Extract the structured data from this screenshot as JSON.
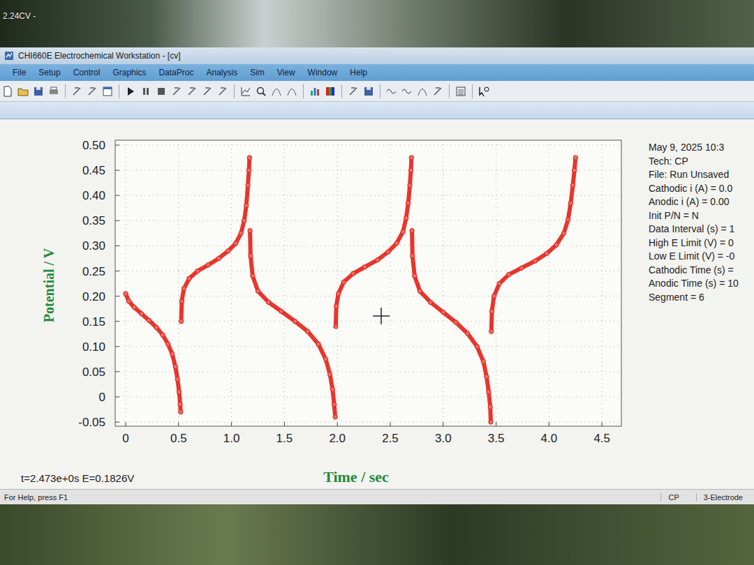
{
  "desktop": {
    "label": "2.24CV -"
  },
  "window": {
    "title": "CHI660E Electrochemical Workstation - [cv]"
  },
  "menu": [
    {
      "label": "File"
    },
    {
      "label": "Setup"
    },
    {
      "label": "Control"
    },
    {
      "label": "Graphics"
    },
    {
      "label": "DataProc"
    },
    {
      "label": "Analysis"
    },
    {
      "label": "Sim"
    },
    {
      "label": "View"
    },
    {
      "label": "Window"
    },
    {
      "label": "Help"
    }
  ],
  "chart": {
    "y_axis": {
      "title": "Potential / V",
      "ticks": [
        "0.50",
        "0.45",
        "0.40",
        "0.35",
        "0.30",
        "0.25",
        "0.20",
        "0.15",
        "0.10",
        "0.05",
        "0",
        "-0.05"
      ]
    },
    "x_axis": {
      "title": "Time / sec",
      "ticks": [
        "0",
        "0.5",
        "1.0",
        "1.5",
        "2.0",
        "2.5",
        "3.0",
        "3.5",
        "4.0",
        "4.5"
      ]
    },
    "segments": [
      {
        "time": [
          0,
          0.03,
          0.08,
          0.15,
          0.22,
          0.29,
          0.35,
          0.4,
          0.44,
          0.47,
          0.49,
          0.505,
          0.515,
          0.52
        ],
        "potential": [
          0.205,
          0.19,
          0.178,
          0.165,
          0.152,
          0.138,
          0.123,
          0.105,
          0.085,
          0.06,
          0.035,
          0.01,
          -0.015,
          -0.03
        ]
      },
      {
        "time": [
          0.525,
          0.53,
          0.55,
          0.6,
          0.68,
          0.78,
          0.88,
          0.97,
          1.04,
          1.09,
          1.12,
          1.14,
          1.155,
          1.165,
          1.17
        ],
        "potential": [
          0.15,
          0.19,
          0.215,
          0.235,
          0.25,
          0.262,
          0.275,
          0.29,
          0.305,
          0.325,
          0.35,
          0.38,
          0.42,
          0.45,
          0.475
        ]
      },
      {
        "time": [
          1.175,
          1.18,
          1.2,
          1.25,
          1.35,
          1.47,
          1.6,
          1.72,
          1.82,
          1.89,
          1.93,
          1.955,
          1.97,
          1.98
        ],
        "potential": [
          0.33,
          0.28,
          0.24,
          0.21,
          0.188,
          0.17,
          0.15,
          0.13,
          0.105,
          0.075,
          0.045,
          0.015,
          -0.015,
          -0.04
        ]
      },
      {
        "time": [
          1.985,
          1.99,
          2.01,
          2.06,
          2.15,
          2.26,
          2.38,
          2.48,
          2.56,
          2.62,
          2.65,
          2.67,
          2.685,
          2.695,
          2.7
        ],
        "potential": [
          0.14,
          0.18,
          0.205,
          0.228,
          0.245,
          0.258,
          0.272,
          0.288,
          0.305,
          0.328,
          0.355,
          0.385,
          0.42,
          0.45,
          0.475
        ]
      },
      {
        "time": [
          2.705,
          2.71,
          2.73,
          2.78,
          2.88,
          3.0,
          3.12,
          3.23,
          3.32,
          3.38,
          3.41,
          3.43,
          3.445,
          3.45
        ],
        "potential": [
          0.33,
          0.28,
          0.24,
          0.21,
          0.188,
          0.168,
          0.148,
          0.126,
          0.1,
          0.07,
          0.04,
          0.01,
          -0.02,
          -0.05
        ]
      },
      {
        "time": [
          3.455,
          3.46,
          3.48,
          3.53,
          3.62,
          3.74,
          3.87,
          3.98,
          4.07,
          4.14,
          4.18,
          4.205,
          4.225,
          4.24,
          4.25
        ],
        "potential": [
          0.13,
          0.17,
          0.2,
          0.225,
          0.243,
          0.256,
          0.27,
          0.285,
          0.302,
          0.325,
          0.352,
          0.385,
          0.42,
          0.45,
          0.475
        ]
      }
    ],
    "cursor_readout": "t=2.473e+0s   E=0.1826V"
  },
  "info": [
    "May 9, 2025   10:3",
    "Tech: CP",
    "File: Run Unsaved",
    "Cathodic i (A) = 0.0",
    "Anodic i (A) = 0.00",
    "Init P/N = N",
    "Data Interval (s) = 1",
    "High E Limit (V) = 0",
    "Low E Limit (V) = -0",
    "Cathodic Time (s) =",
    "Anodic Time (s) = 10",
    "Segment = 6"
  ],
  "status_bar": {
    "help": "For Help, press F1",
    "technique": "CP",
    "mode": "3-Electrode"
  }
}
